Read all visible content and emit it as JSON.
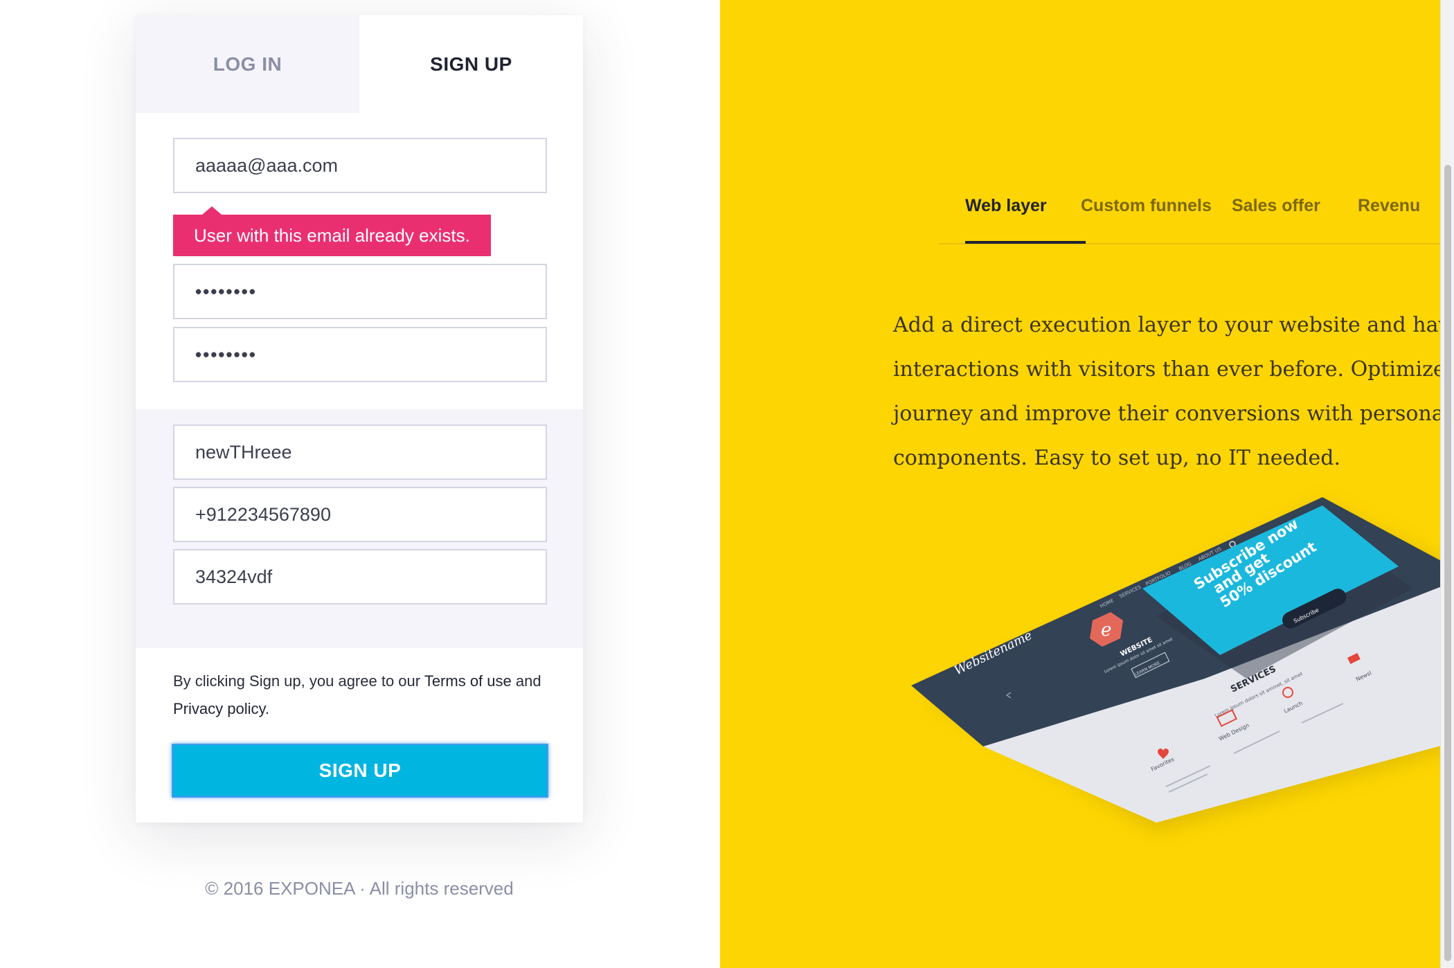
{
  "auth": {
    "tabs": [
      {
        "label": "LOG IN",
        "active": false
      },
      {
        "label": "SIGN UP",
        "active": true
      }
    ],
    "fields": {
      "email": "aaaaa@aaa.com",
      "password": "••••••••",
      "password_confirm": "••••••••",
      "company": "newTHreee",
      "phone": "+912234567890",
      "code": "34324vdf"
    },
    "error": "User with this email already exists.",
    "terms": {
      "prefix": "By clicking Sign up, you agree to our",
      "terms_link": "Terms of use",
      "and": "and",
      "privacy_link": "Privacy policy",
      "suffix": "."
    },
    "submit_label": "SIGN UP",
    "error_color": "#ea2f71",
    "accent_color": "#00b5e0"
  },
  "footer": "© 2016 EXPONEA · All rights reserved",
  "promo": {
    "background": "#fdd502",
    "tabs": [
      {
        "label": "Web layer",
        "active": true
      },
      {
        "label": "Custom funnels",
        "active": false
      },
      {
        "label": "Sales offer",
        "active": false
      },
      {
        "label": "Revenu",
        "active": false
      }
    ],
    "description_lines": [
      "Add a direct execution layer to your website and have be",
      "interactions with visitors than ever before. Optimize you",
      "journey and improve their conversions with personalize",
      "components. Easy to set up, no IT needed."
    ],
    "illustration": {
      "logo": "Websitename",
      "nav": [
        "HOME",
        "SERVICES",
        "PORTFOLIO",
        "BLOG",
        "ABOUT US"
      ],
      "hero_title": "WEBSITE",
      "hero_sub": "Lorem ipsum dolor sit amet sit amet",
      "hero_button": "LEARN MORE",
      "popup_lines": [
        "Subscribe now",
        "and get",
        "50% discount"
      ],
      "popup_button": "Subscribe",
      "services_title": "SERVICES",
      "services_sub": "Lorem ipsum dolors sit ammet, sit amet",
      "service_items": [
        "Favorites",
        "Web Design",
        "Launch",
        "Newsl"
      ]
    }
  }
}
